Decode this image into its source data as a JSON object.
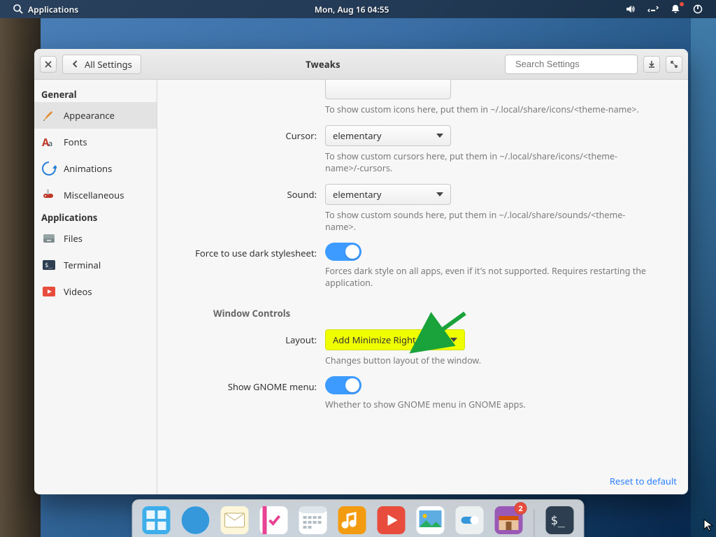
{
  "panel": {
    "apps_label": "Applications",
    "clock": "Mon, Aug 16    04:55"
  },
  "window": {
    "close_tooltip": "Close",
    "back_label": "All Settings",
    "title": "Tweaks",
    "search_placeholder": "Search Settings"
  },
  "sidebar": {
    "sections": [
      {
        "title": "General",
        "items": [
          {
            "label": "Appearance",
            "icon": "paintbrush",
            "selected": true
          },
          {
            "label": "Fonts",
            "icon": "font"
          },
          {
            "label": "Animations",
            "icon": "spin-arrow"
          },
          {
            "label": "Miscellaneous",
            "icon": "swiss-knife"
          }
        ]
      },
      {
        "title": "Applications",
        "items": [
          {
            "label": "Files",
            "icon": "drawer"
          },
          {
            "label": "Terminal",
            "icon": "terminal"
          },
          {
            "label": "Videos",
            "icon": "play"
          }
        ]
      }
    ]
  },
  "settings": {
    "icons_hint": "To show custom icons here, put them in ~/.local/share/icons/<theme-name>.",
    "cursor_label": "Cursor:",
    "cursor_value": "elementary",
    "cursor_hint": "To show custom cursors here, put them in ~/.local/share/icons/<theme-name>/-cursors.",
    "sound_label": "Sound:",
    "sound_value": "elementary",
    "sound_hint": "To show custom sounds here, put them in ~/.local/share/sounds/<theme-name>.",
    "dark_label": "Force to use dark stylesheet:",
    "dark_hint": "Forces dark style on all apps, even if it's not supported. Requires restarting the application.",
    "window_controls_heading": "Window Controls",
    "layout_label": "Layout:",
    "layout_value": "Add Minimize Right",
    "layout_hint": "Changes button layout of the window.",
    "gnome_menu_label": "Show GNOME menu:",
    "gnome_menu_hint": "Whether to show GNOME menu in GNOME apps.",
    "reset_label": "Reset to default"
  },
  "dock": {
    "items": [
      {
        "name": "multitasking",
        "color": "#3daee9"
      },
      {
        "name": "web-browser",
        "color": "#2ecc71"
      },
      {
        "name": "mail",
        "color": "#f0e6a3"
      },
      {
        "name": "tasks",
        "color": "#ef6ea8"
      },
      {
        "name": "calendar",
        "color": "#ffffff"
      },
      {
        "name": "music",
        "color": "#f39c12"
      },
      {
        "name": "videos",
        "color": "#e74c3c"
      },
      {
        "name": "photos",
        "color": "#5dade2"
      },
      {
        "name": "switchboard",
        "color": "#5dade2"
      },
      {
        "name": "appcenter",
        "color": "#f5b7b1",
        "badge": "2"
      },
      {
        "separator": true
      },
      {
        "name": "terminal",
        "color": "#2c3e50"
      }
    ]
  }
}
